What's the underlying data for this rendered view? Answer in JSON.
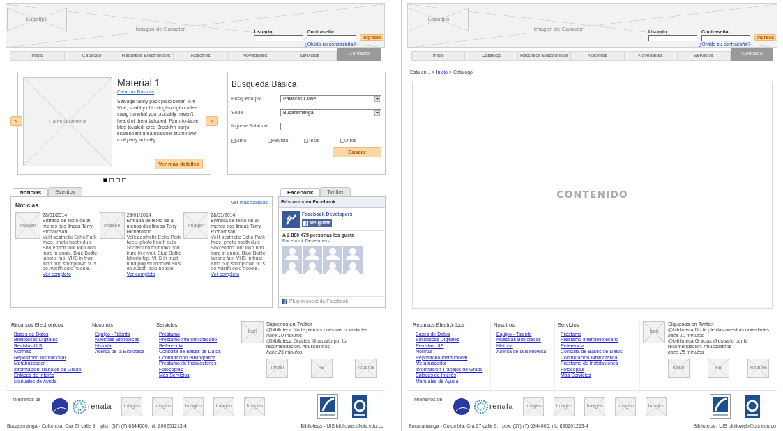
{
  "pages": [
    {
      "kind": "home",
      "header": {
        "logo": "Logotipo",
        "banner": "Imagen de Caracter",
        "user_label": "Usuario",
        "password_label": "Contraseña",
        "login_button": "Ingresar",
        "forgot_link": "¿Olvido su contraseña?"
      },
      "nav": {
        "items": [
          "Inicio",
          "Catalogo",
          "Recursos Electrónicos",
          "Nosotros",
          "Novedades",
          "Servicios"
        ],
        "contact": "Contacto"
      },
      "slider": {
        "prev": "<",
        "next": ">",
        "cover": "Caratula Material",
        "title": "Material 1",
        "category": "Ciencias Básicas",
        "description": "Selvage fanny pack plaid seitan lo-fi Vice, shabby chic single-origin coffee swag narwhal you probably haven't heard of them tattooed. Farm-to-table blog tousled, cred Brooklyn banjo skateboard dreamcatcher stumptown roof party actually",
        "button": "Ver más detalles",
        "dots": [
          {
            "selected": true
          },
          {
            "selected": false
          },
          {
            "selected": false
          },
          {
            "selected": false
          }
        ]
      },
      "search": {
        "title": "Búsqueda Básica",
        "fields": [
          {
            "kind": "select",
            "label": "Búsqueda por",
            "value": "Palabras Clave"
          },
          {
            "kind": "select",
            "label": "Sede",
            "value": "Bucaramanga"
          },
          {
            "kind": "text",
            "label": "Ingrese Palabras"
          }
        ],
        "checkboxes": [
          {
            "label": "Libro",
            "checked": true
          },
          {
            "label": "Revista",
            "checked": false
          },
          {
            "label": "Tesis",
            "checked": false
          },
          {
            "label": "Otros",
            "checked": false
          }
        ],
        "button": "Buscar"
      },
      "news": {
        "tabs": [
          {
            "label": "Noticias",
            "selected": true
          },
          {
            "label": "Eventos",
            "selected": false
          }
        ],
        "heading": "Noticias",
        "more_link": "Ver más Noticias",
        "items": [
          {
            "image": "Imagen",
            "date": "28/01/2014",
            "title": "Entrada de texto de al menos dos lineas Terry Richardson.",
            "body": "Velit aesthetic Echo Park twee, photo booth duis Shoreditch four loko non irure in ennui. Blue Bottle laboris fap, VHS in trust fund pug stumptown 90's do Austin odio hoodie.",
            "link": "Ver completo"
          },
          {
            "image": "Imagen",
            "date": "28/01/2014",
            "title": "Entrada de texto de al menos dos lineas Terry Richardson.",
            "body": "Velit aesthetic Echo Park twee, photo booth duis Shoreditch four loko non irure in ennui. Blue Bottle laboris fap, VHS in trust fund pug stumptown 90's do Austin odio hoodie.",
            "link": "Ver completo"
          },
          {
            "image": "Imagen",
            "date": "28/01/2014",
            "title": "Entrada de texto de al menos dos lineas Terry Richardson.",
            "body": "Velit aesthetic Echo Park twee, photo booth duis Shoreditch four loko non irure in ennui. Blue Bottle laboris fap, VHS in trust fund pug stumptown 90's do Austin odio hoodie.",
            "link": "Ver completo"
          }
        ]
      },
      "social": {
        "tabs": [
          {
            "label": "Facebook",
            "selected": true
          },
          {
            "label": "Twitter",
            "selected": false
          }
        ],
        "header": "Búscanos en Facebook",
        "page_name": "Facebook Developers",
        "like_button": "Me gusta",
        "count_text": "A 2 880 475 personas les gusta",
        "count_link": "Facebook Developers.",
        "plugin_text": "Plug-in social de Facebook"
      },
      "footer": {
        "columns": [
          {
            "title": "Recursos Electrónicos",
            "links": [
              "Bases de Datos",
              "Bibliotecas Digitales",
              "Revistas UIS",
              "Normas",
              "Repositorio Institucional",
              "Metabuscador",
              "Información Trabajos de Grado",
              "Enlaces de Interés",
              "Manuales de Ayuda"
            ]
          },
          {
            "title": "Nosotros",
            "links": [
              "Equipo - Talento",
              "Nuestras Bibliotecas",
              "Historia",
              "Acerca de la Biblioteca"
            ]
          },
          {
            "title": "Servicios",
            "links": [
              "Préstamo",
              "Préstamo Interbibliotecario",
              "Referencia",
              "Consulta de Bases de Datos",
              "Conmutación Bibliográfica",
              "Prestamo de Instalaciones",
              "Fotocopias",
              "Más Servicios"
            ]
          }
        ],
        "twitter": {
          "icon": "Icon",
          "title": "Siguenos en Twitter",
          "tweets": [
            {
              "text": "@biblioteca No te pierdas nuestras novedades.",
              "time": "hace 10 minutos"
            },
            {
              "text": "@biblioteca Gracias @usuario por tu recomendacion. #buscolibros",
              "time": "hace 25 minutos"
            }
          ],
          "buttons": [
            "Twitter",
            "FB",
            "Youtube"
          ]
        },
        "members_label": "Miembros de",
        "member_logo_text": "renata",
        "member_images": [
          "Imagen",
          "Imagen",
          "Imagen",
          "Imagen",
          "Imagen"
        ],
        "address": "Bucaramanga - Colombia. Cra 27 calle 9.   pbx: (57) (7) 6344000. nit: 890201213-4",
        "contact": "Biblioteca - UIS biblioweb@uis.edu.co"
      }
    },
    {
      "kind": "catalog",
      "header": {
        "logo": "Logotipo",
        "banner": "Imagen de Caracter",
        "user_label": "Usuario",
        "password_label": "Contraseña",
        "login_button": "Ingresa",
        "forgot_link": "¿Olvido su contraseña?"
      },
      "nav": {
        "items": [
          "Inicio",
          "Catalogo",
          "Recursos Electrónicos",
          "Nosotros",
          "Novedades",
          "Servicios"
        ],
        "contact": "Contacto"
      },
      "breadcrumb": {
        "prefix": "Esta en... >",
        "link": "Inicio",
        "current": "> Catalogo"
      },
      "content": "CONTENIDO",
      "footer": {
        "columns": [
          {
            "title": "Recursos Electrónicos",
            "links": [
              "Bases de Datos",
              "Bibliotecas Digitales",
              "Revistas UIS",
              "Normas",
              "Repositorio Institucional",
              "Metabuscador",
              "Información Trabajos de Grado",
              "Enlaces de Interés",
              "Manuales de Ayuda"
            ]
          },
          {
            "title": "Nosotros",
            "links": [
              "Equipo - Talento",
              "Nuestras Bibliotecas",
              "Historia",
              "Acerca de la Biblioteca"
            ]
          },
          {
            "title": "Servicios",
            "links": [
              "Préstamo",
              "Préstamo Interbibliotecario",
              "Referencia",
              "Consulta de Bases de Datos",
              "Conmutación Bibliográfica",
              "Prestamo de Instalaciones",
              "Fotocopias",
              "Más Servicios"
            ]
          }
        ],
        "twitter": {
          "icon": "Icon",
          "title": "Siguenos en Twitter",
          "tweets": [
            {
              "text": "@biblioteca No te pierdas nuestras novedades.",
              "time": "hace 10 minutos"
            },
            {
              "text": "@biblioteca Gracias @usuario por tu recomendacion. #buscolibros",
              "time": "hace 25 minutos"
            }
          ],
          "buttons": [
            "Twitter",
            "FB",
            "Youtube"
          ]
        },
        "members_label": "Miembros de",
        "member_logo_text": "renata",
        "member_images": [
          "Imagen",
          "Imagen",
          "Imagen",
          "Imagen",
          "Imagen"
        ],
        "address": "Bucaramanga - Colombia. Cra 27 calle 9.   pbx: (57) (7) 6344000. nit: 890201213-4",
        "contact": "Biblioteca - UIS biblioweb@uis.edu.co"
      }
    }
  ]
}
